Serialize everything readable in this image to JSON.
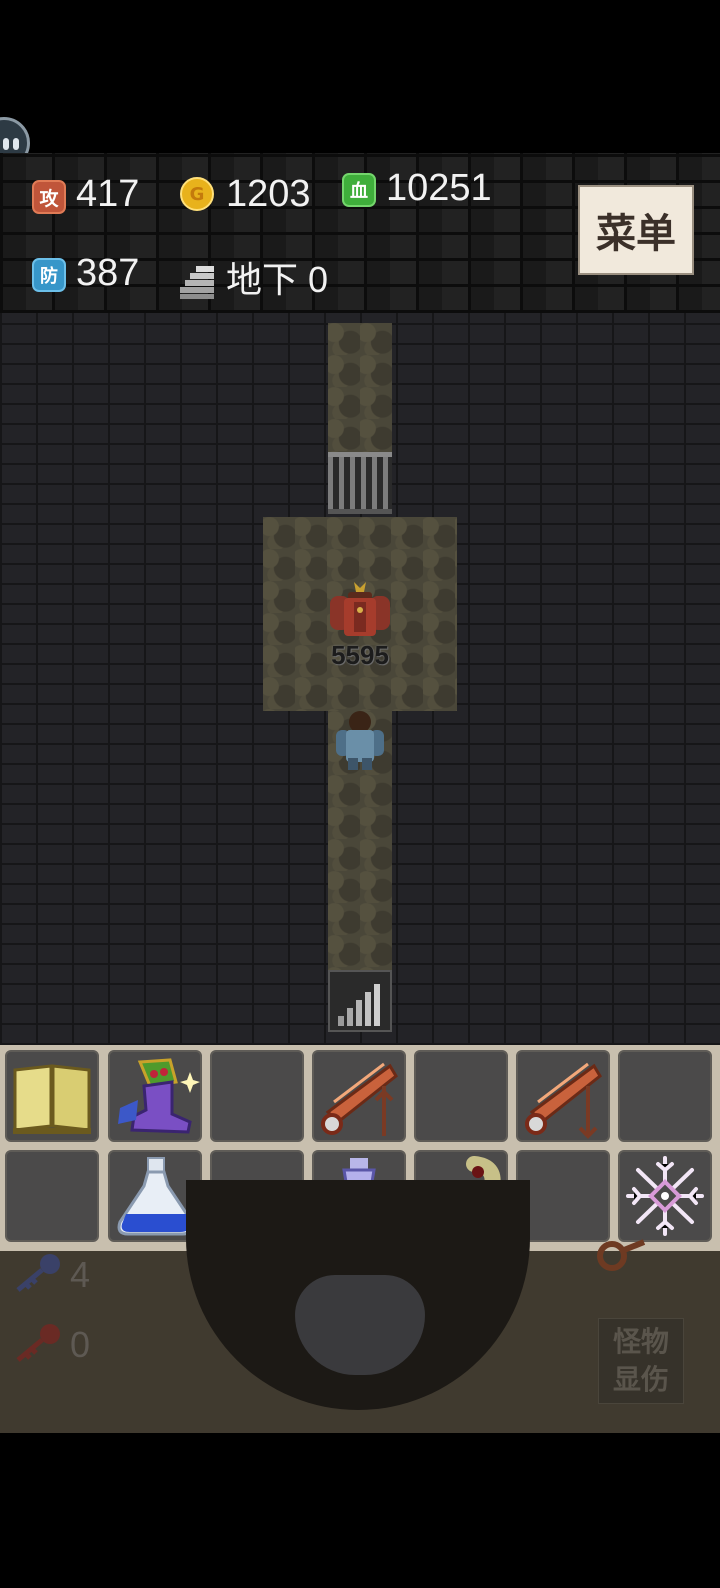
{
  "stats": {
    "attack": {
      "icon_char": "攻",
      "value": "417"
    },
    "gold": {
      "icon_char": "G",
      "value": "1203"
    },
    "hp": {
      "icon_char": "血",
      "value": "10251"
    },
    "defense": {
      "icon_char": "防",
      "value": "387"
    },
    "floor": {
      "value": "地下 0"
    }
  },
  "menu_label": "菜单",
  "monster": {
    "damage": "5595"
  },
  "items": {
    "row1": [
      "book-icon",
      "winged-boots-icon",
      "",
      "flying-wand-icon",
      "",
      "flying-wand-icon",
      ""
    ],
    "row2": [
      "",
      "blue-potion-flask-icon",
      "",
      "holy-water-vase-icon",
      "sand-worm-icon",
      "",
      "snowflake-icon"
    ]
  },
  "keys": {
    "blue": "4",
    "red": "0"
  },
  "damage_toggle_label": "怪物显伤",
  "colors": {
    "attack": "#c0553a",
    "gold": "#e8b21c",
    "hp": "#3fae3b",
    "defense": "#3796c9",
    "menu_bg": "#f1e9dc"
  }
}
